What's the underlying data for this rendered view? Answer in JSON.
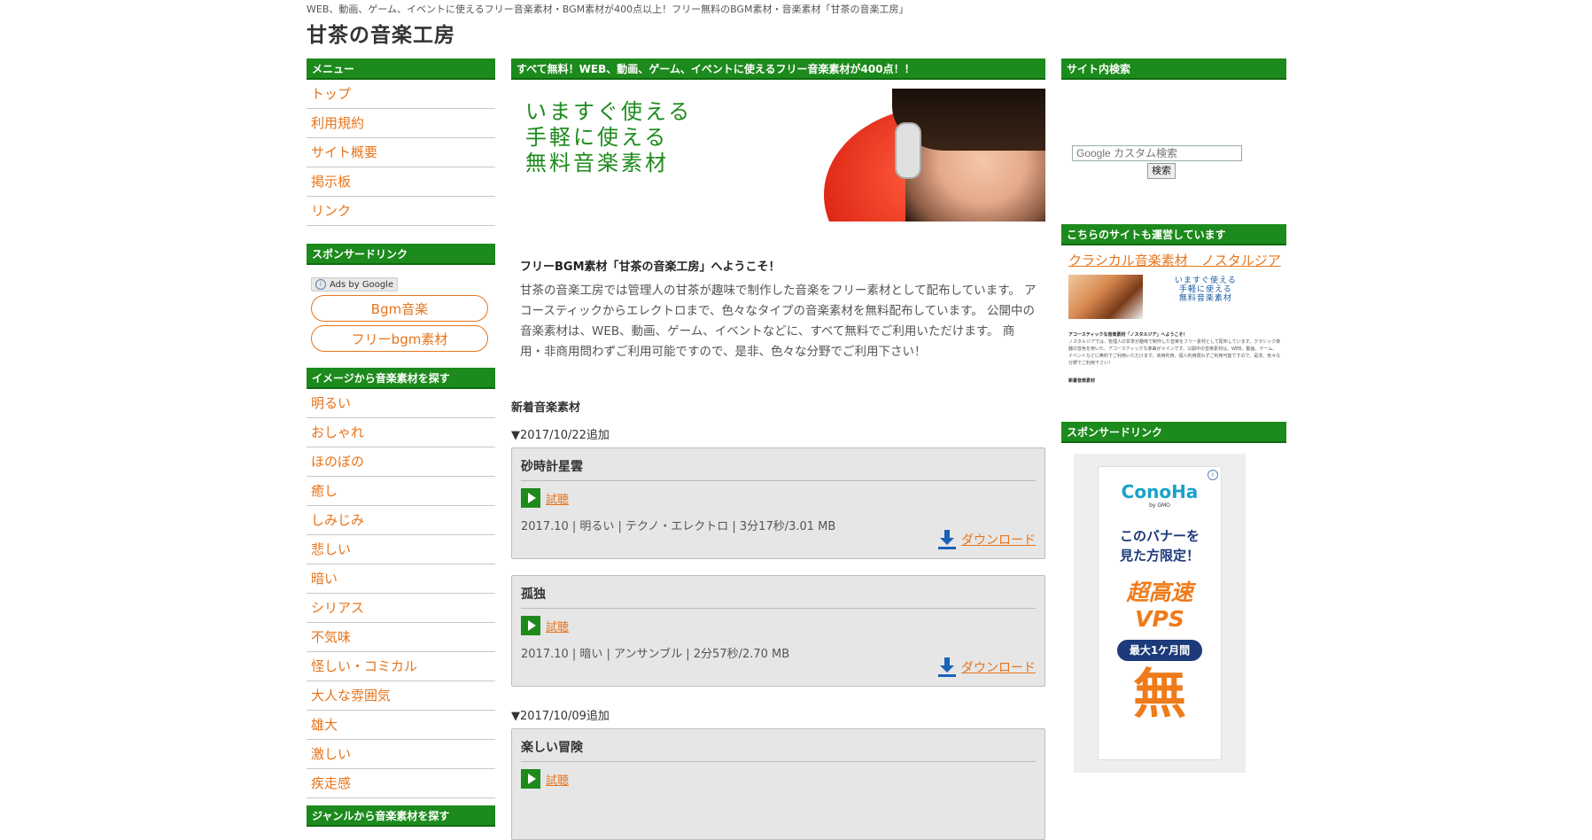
{
  "header": {
    "tagline": "WEB、動画、ゲーム、イベントに使えるフリー音楽素材・BGM素材が400点以上！フリー無料のBGM素材・音楽素材「甘茶の音楽工房」",
    "site_title": "甘茶の音楽工房"
  },
  "left": {
    "menu_head": "メニュー",
    "menu": [
      "トップ",
      "利用規約",
      "サイト概要",
      "掲示板",
      "リンク"
    ],
    "sponsor_head": "スポンサードリンク",
    "ads_label": "Ads by Google",
    "ad_links": [
      "Bgm音楽",
      "フリーbgm素材"
    ],
    "image_head": "イメージから音楽素材を探す",
    "image_items": [
      "明るい",
      "おしゃれ",
      "ほのぼの",
      "癒し",
      "しみじみ",
      "悲しい",
      "暗い",
      "シリアス",
      "不気味",
      "怪しい・コミカル",
      "大人な雰囲気",
      "雄大",
      "激しい",
      "疾走感"
    ],
    "next_head": "ジャンルから音楽素材を探す"
  },
  "main": {
    "banner_head": "すべて無料！WEB、動画、ゲーム、イベントに使えるフリー音楽素材が400点！！",
    "hero_lines": [
      "いますぐ使える",
      "手軽に使える",
      "無料音楽素材"
    ],
    "welcome_title": "フリーBGM素材「甘茶の音楽工房」へようこそ！",
    "welcome_text": "甘茶の音楽工房では管理人の甘茶が趣味で制作した音楽をフリー素材として配布しています。 アコースティックからエレクトロまで、色々なタイプの音楽素材を無料配布しています。 公開中の音楽素材は、WEB、動画、ゲーム、イベントなどに、すべて無料でご利用いただけます。 商用・非商用問わずご利用可能ですので、是非、色々な分野でご利用下さい！",
    "new_head": "新着音楽素材",
    "listen_label": "試聴",
    "download_label": "ダウンロード",
    "groups": [
      {
        "date": "▼2017/10/22追加",
        "tracks": [
          {
            "title": "砂時計星雲",
            "meta": "2017.10 | 明るい | テクノ・エレクトロ | 3分17秒/3.01 MB"
          },
          {
            "title": "孤独",
            "meta": "2017.10 | 暗い | アンサンブル | 2分57秒/2.70 MB"
          }
        ]
      },
      {
        "date": "▼2017/10/09追加",
        "tracks": [
          {
            "title": "楽しい冒険",
            "meta": ""
          }
        ]
      }
    ]
  },
  "right": {
    "search_head": "サイト内検索",
    "search_placeholder": "Google カスタム検索",
    "search_button": "検索",
    "other_head": "こちらのサイトも運営しています",
    "other_link": "クラシカル音楽素材　ノスタルジア",
    "thumb_copy": [
      "いますぐ使える",
      "手軽に使える",
      "無料音楽素材"
    ],
    "thumb_title": "アコースティックな音楽素材「ノスタルジア」へようこそ！",
    "thumb_text": "ノスタルジアでは、管理人の甘茶が趣味で制作した音楽をフリー素材として配布しています。クラシック楽器の音色を用いた、アコースティックな楽曲がメインです。公開中の音楽素材は、WEB、動画、ゲーム、イベントなどに無料でご利用いただけます。商用利用、個人利用問わずご利用可能ですので、是非、色々な分野でご利用下さい！",
    "thumb_new": "新着音楽素材",
    "sponsor_head": "スポンサードリンク",
    "ad": {
      "logo": "ConoHa",
      "logo_sub": "by GMO",
      "lead1": "このバナーを",
      "lead2": "見た方限定！",
      "big1": "超高速",
      "big2": "VPS",
      "pill": "最大1ケ月間",
      "huge": "無"
    }
  },
  "colors": {
    "accent_green": "#1c8a1c",
    "link_orange": "#e8741a",
    "download_blue": "#1a62b8"
  }
}
